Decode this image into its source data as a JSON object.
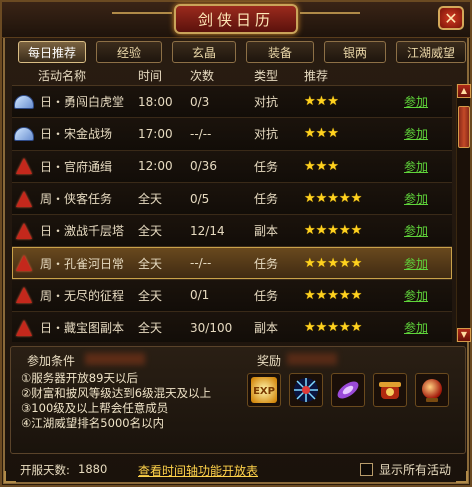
{
  "window": {
    "title": "剑侠日历",
    "close_symbol": "✕"
  },
  "tabs": [
    {
      "label": "每日推荐",
      "active": true
    },
    {
      "label": "经验",
      "active": false
    },
    {
      "label": "玄晶",
      "active": false
    },
    {
      "label": "装备",
      "active": false
    },
    {
      "label": "银两",
      "active": false
    },
    {
      "label": "江湖威望",
      "active": false
    }
  ],
  "table": {
    "headers": {
      "name": "活动名称",
      "time": "时间",
      "count": "次数",
      "type": "类型",
      "rating": "推荐"
    },
    "join_label": "参加",
    "rows": [
      {
        "icon": "fan-icon",
        "name": "日・勇闯白虎堂",
        "time": "18:00",
        "count": "0/3",
        "type": "对抗",
        "stars": 3,
        "star_text": "★★★",
        "selected": false
      },
      {
        "icon": "fan-icon",
        "name": "日・宋金战场",
        "time": "17:00",
        "count": "--/--",
        "type": "对抗",
        "stars": 3,
        "star_text": "★★★",
        "selected": false
      },
      {
        "icon": "cone-icon",
        "name": "日・官府通缉",
        "time": "12:00",
        "count": "0/36",
        "type": "任务",
        "stars": 3,
        "star_text": "★★★",
        "selected": false
      },
      {
        "icon": "cone-icon",
        "name": "周・侠客任务",
        "time": "全天",
        "count": "0/5",
        "type": "任务",
        "stars": 5,
        "star_text": "★★★★★",
        "selected": false
      },
      {
        "icon": "cone-icon",
        "name": "日・激战千层塔",
        "time": "全天",
        "count": "12/14",
        "type": "副本",
        "stars": 5,
        "star_text": "★★★★★",
        "selected": false
      },
      {
        "icon": "cone-icon",
        "name": "周・孔雀河日常",
        "time": "全天",
        "count": "--/--",
        "type": "任务",
        "stars": 5,
        "star_text": "★★★★★",
        "selected": true
      },
      {
        "icon": "cone-icon",
        "name": "周・无尽的征程",
        "time": "全天",
        "count": "0/1",
        "type": "任务",
        "stars": 5,
        "star_text": "★★★★★",
        "selected": false
      },
      {
        "icon": "cone-icon",
        "name": "日・藏宝图副本",
        "time": "全天",
        "count": "30/100",
        "type": "副本",
        "stars": 5,
        "star_text": "★★★★★",
        "selected": false
      }
    ]
  },
  "conditions": {
    "title": "参加条件",
    "items": [
      "①服务器开放89天以后",
      "②财富和披风等级达到6级混天及以上",
      "③100级及以上帮会任意成员",
      "④江湖威望排名5000名以内"
    ]
  },
  "rewards": {
    "title": "奖励",
    "items": [
      {
        "name": "exp-reward-icon",
        "badge": "EXP"
      },
      {
        "name": "blue-star-reward-icon"
      },
      {
        "name": "purple-gem-reward-icon"
      },
      {
        "name": "treasure-pot-reward-icon"
      },
      {
        "name": "red-orb-reward-icon"
      }
    ]
  },
  "footer": {
    "days_label": "开服天数:",
    "days_value": "1880",
    "timeline_link": "查看时间轴功能开放表",
    "show_all_label": "显示所有活动",
    "show_all_checked": false
  }
}
